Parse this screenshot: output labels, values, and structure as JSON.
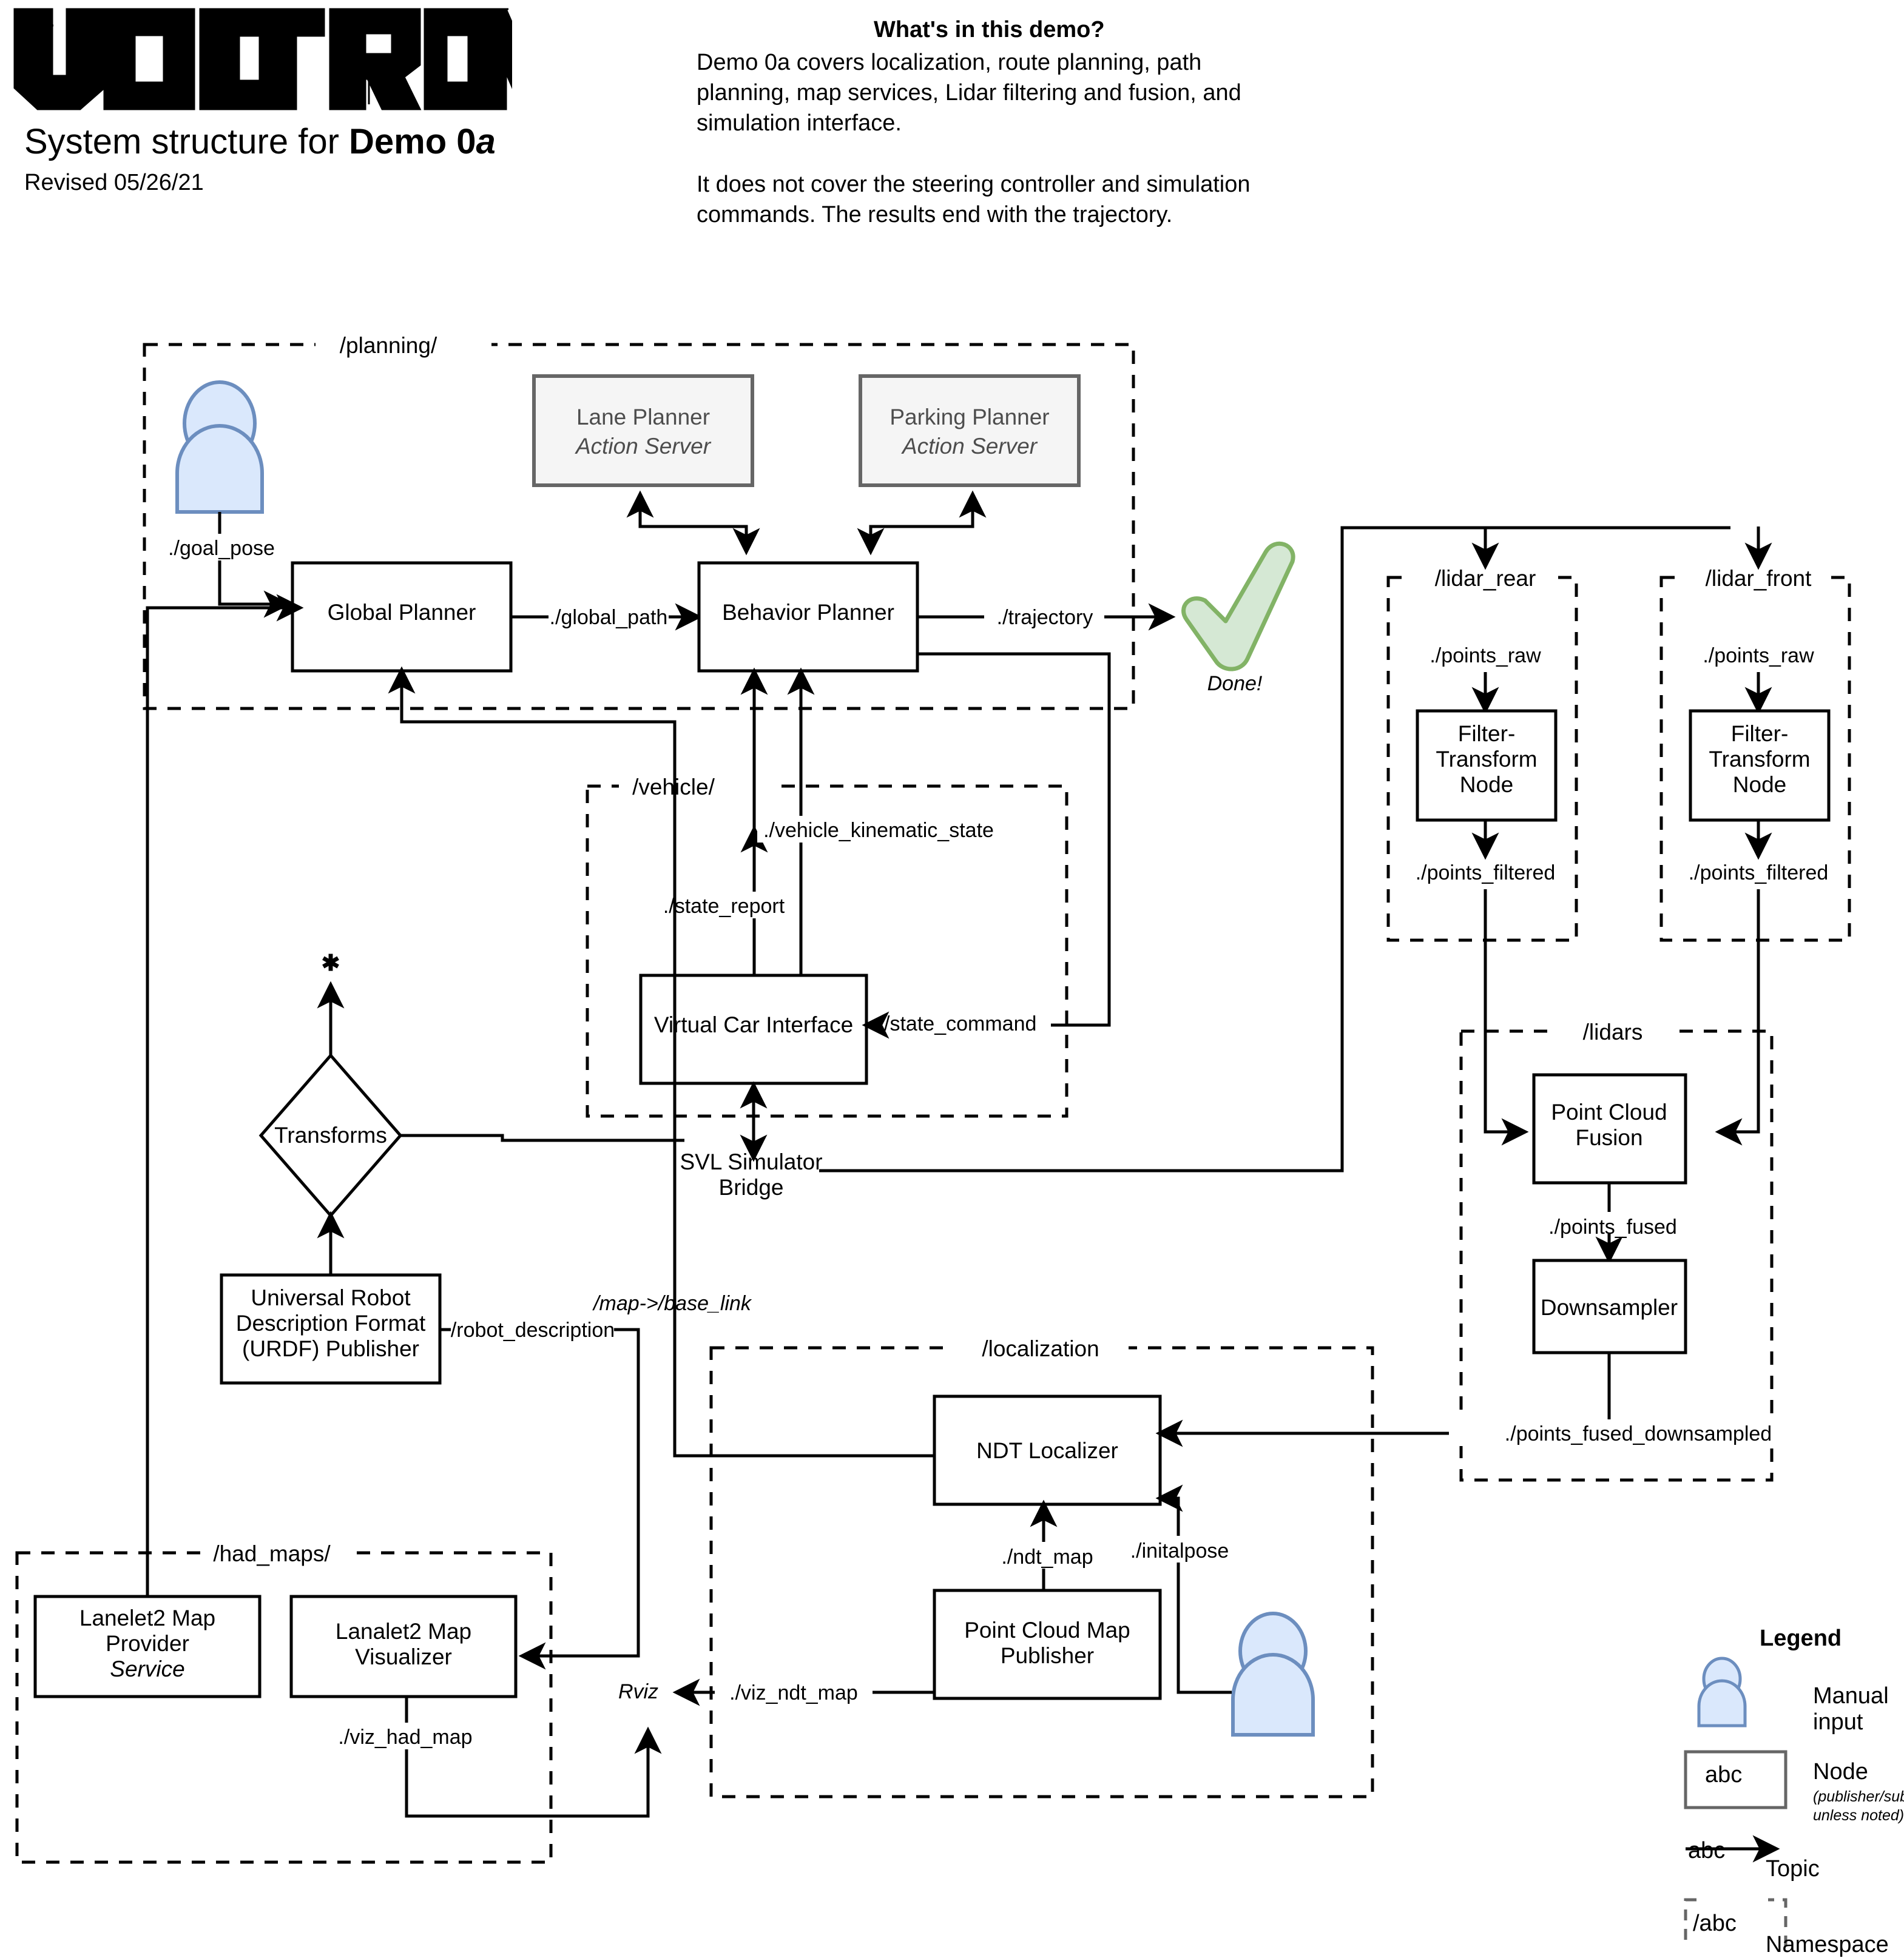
{
  "header": {
    "logo_text": "VOLTRON",
    "title_prefix": "System structure for ",
    "title_emphasis": "Demo 0",
    "title_emphasis_italic": "a",
    "revision": "Revised 05/26/21",
    "demo_question": "What's in this demo?",
    "demo_paragraph_1": "Demo 0a covers localization, route planning, path planning, map services, Lidar filtering and fusion, and simulation interface.",
    "demo_paragraph_2": "It does not cover the steering controller and simulation commands. The results end with the trajectory."
  },
  "namespaces": {
    "planning": "/planning/",
    "vehicle": "/vehicle/",
    "lidar_rear": "/lidar_rear",
    "lidar_front": "/lidar_front",
    "lidars": "/lidars",
    "localization": "/localization",
    "had_maps": "/had_maps/"
  },
  "nodes": {
    "lane_planner": {
      "name": "Lane Planner",
      "subtitle": "Action Server"
    },
    "parking_planner": {
      "name": "Parking Planner",
      "subtitle": "Action Server"
    },
    "global_planner": {
      "name": "Global Planner"
    },
    "behavior_planner": {
      "name": "Behavior Planner"
    },
    "virtual_car_interface": {
      "name": "Virtual Car Interface"
    },
    "filter_transform_rear": {
      "line1": "Filter-",
      "line2": "Transform",
      "line3": "Node"
    },
    "filter_transform_front": {
      "line1": "Filter-",
      "line2": "Transform",
      "line3": "Node"
    },
    "point_cloud_fusion": {
      "line1": "Point Cloud",
      "line2": "Fusion"
    },
    "downsampler": {
      "name": "Downsampler"
    },
    "ndt_localizer": {
      "name": "NDT Localizer"
    },
    "point_cloud_map_publisher": {
      "line1": "Point Cloud Map",
      "line2": "Publisher"
    },
    "urdf_publisher": {
      "line1": "Universal Robot",
      "line2": "Description Format",
      "line3": "(URDF) Publisher"
    },
    "lanelet2_map_provider": {
      "line1": "Lanelet2 Map",
      "line2": "Provider",
      "subtitle": "Service"
    },
    "lanelet2_map_visualizer": {
      "line1": "Lanalet2 Map",
      "line2": "Visualizer"
    },
    "transforms": {
      "name": "Transforms"
    },
    "svl_bridge": {
      "line1": "SVL Simulator",
      "line2": "Bridge"
    },
    "rviz": {
      "name": "Rviz"
    },
    "done": {
      "label": "Done!"
    },
    "asterisk": {
      "glyph": "✱"
    }
  },
  "topics": {
    "goal_pose": "./goal_pose",
    "global_path": "./global_path",
    "trajectory": "./trajectory",
    "vehicle_kinematic_state": "./vehicle_kinematic_state",
    "state_report": "./state_report",
    "state_command": "./state_command",
    "points_raw_rear": "./points_raw",
    "points_raw_front": "./points_raw",
    "points_filtered_rear": "./points_filtered",
    "points_filtered_front": "./points_filtered",
    "points_fused": "./points_fused",
    "points_fused_downsampled": "./points_fused_downsampled",
    "ndt_map": "./ndt_map",
    "initalpose": "./initalpose",
    "viz_ndt_map": "./viz_ndt_map",
    "viz_had_map": "./viz_had_map",
    "robot_description": "/robot_description",
    "map_to_base_link": "/map->/base_link"
  },
  "legend": {
    "title": "Legend",
    "manual_input": "Manual input",
    "node": "Node",
    "node_sub": "(publisher/subscriber unless noted)",
    "topic": "Topic",
    "namespace": "Namespace",
    "sample_abc": "abc",
    "sample_abc_ns": "/abc"
  },
  "colors": {
    "person_fill": "#dae8fc",
    "person_stroke": "#6c8ebf",
    "action_server_fill": "#f5f5f5",
    "action_server_stroke": "#666666",
    "check_fill": "#d5e8d4",
    "check_stroke": "#82b366",
    "line": "#000000"
  }
}
